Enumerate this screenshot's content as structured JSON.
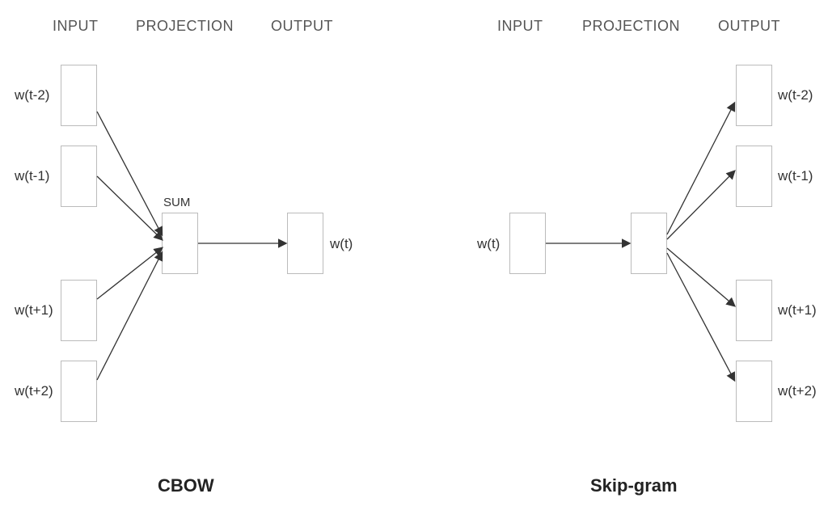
{
  "headers": {
    "left": {
      "input": "INPUT",
      "projection": "PROJECTION",
      "output": "OUTPUT"
    },
    "right": {
      "input": "INPUT",
      "projection": "PROJECTION",
      "output": "OUTPUT"
    }
  },
  "cbow": {
    "title": "CBOW",
    "sum": "SUM",
    "inputs": [
      "w(t-2)",
      "w(t-1)",
      "w(t+1)",
      "w(t+2)"
    ],
    "output": "w(t)"
  },
  "skipgram": {
    "title": "Skip-gram",
    "input": "w(t)",
    "outputs": [
      "w(t-2)",
      "w(t-1)",
      "w(t+1)",
      "w(t+2)"
    ]
  }
}
